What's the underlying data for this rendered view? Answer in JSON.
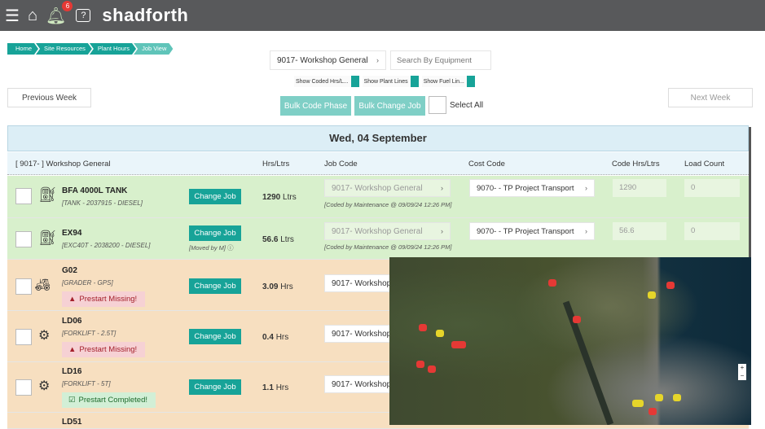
{
  "header": {
    "brand": "shadforth",
    "notification_count": "6"
  },
  "breadcrumb": [
    "Home",
    "Site Resources",
    "Plant Hours",
    "Job View"
  ],
  "job_filter": "9017- Workshop General",
  "search_placeholder": "Search By Equipment",
  "toggles": [
    "Show Coded Hrs/L...",
    "Show Plant Lines",
    "Show Fuel Lin..."
  ],
  "buttons": {
    "prev": "Previous Week",
    "next": "Next Week",
    "bulk_code": "Bulk Code Phase",
    "bulk_change": "Bulk Change Job",
    "select_all": "Select All",
    "change_job": "Change Job"
  },
  "date": "Wed, 04 September",
  "columns": {
    "job": "[ 9017- ] Workshop General",
    "hrs": "Hrs/Ltrs",
    "job_code": "Job Code",
    "cost_code": "Cost Code",
    "code_hrs": "Code Hrs/Ltrs",
    "load": "Load Count"
  },
  "rows": [
    {
      "name": "BFA 4000L TANK",
      "sub": "[TANK - 2037915 - DIESEL]",
      "qty": "1290",
      "unit": "Ltrs",
      "job": "9017- Workshop General",
      "coded": "[Coded by Maintenance @ 09/09/24 12:26 PM]",
      "cost": "9070- - TP Project Transport",
      "code_hrs": "1290",
      "load": "0"
    },
    {
      "name": "EX94",
      "sub": "[EXC40T - 2038200 - DIESEL]",
      "moved": "[Moved by M]",
      "qty": "56.6",
      "unit": "Ltrs",
      "job": "9017- Workshop General",
      "coded": "[Coded by Maintenance @ 09/09/24 12:26 PM]",
      "cost": "9070- - TP Project Transport",
      "code_hrs": "56.6",
      "load": "0"
    },
    {
      "name": "G02",
      "sub": "[GRADER - GPS]",
      "status": "Prestart Missing!",
      "qty": "3.09",
      "unit": "Hrs",
      "job": "9017- Workshop"
    },
    {
      "name": "LD06",
      "sub": "[FORKLIFT - 2.5T]",
      "status": "Prestart Missing!",
      "qty": "0.4",
      "unit": "Hrs",
      "job": "9017- Workshop"
    },
    {
      "name": "LD16",
      "sub": "[FORKLIFT - 5T]",
      "status": "Prestart Completed!",
      "qty": "1.1",
      "unit": "Hrs",
      "job": "9017- Workshop"
    },
    {
      "name": "LD51"
    }
  ],
  "map": {
    "zoom_in": "+",
    "zoom_out": "−"
  }
}
